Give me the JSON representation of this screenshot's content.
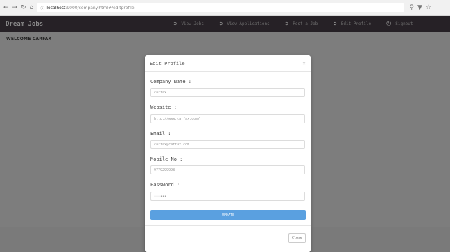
{
  "browser": {
    "url_host": "localhost",
    "url_path": ":9000/company.html#/editprofile"
  },
  "navbar": {
    "brand": "Dream Jobs",
    "links": [
      {
        "label": "View Jobs"
      },
      {
        "label": "View Applications"
      },
      {
        "label": "Post a Job"
      },
      {
        "label": "Edit Profile"
      },
      {
        "label": "Signout"
      }
    ]
  },
  "page": {
    "welcome": "WELCOME CARFAX"
  },
  "modal": {
    "title": "Edit Profile",
    "close_symbol": "×",
    "fields": [
      {
        "label": "Company Name :",
        "value": "carfax"
      },
      {
        "label": "Website :",
        "value": "http://www.carfax.com/"
      },
      {
        "label": "Email :",
        "value": "carfax@carfax.com"
      },
      {
        "label": "Mobile No :",
        "value": "9779299998"
      },
      {
        "label": "Password :",
        "value": "••••••"
      }
    ],
    "update_label": "UPDATE",
    "close_label": "Close"
  },
  "colors": {
    "navbar_bg": "#262126",
    "overlay_bg": "#7d7d7d",
    "update_button": "#5aa0e0"
  }
}
